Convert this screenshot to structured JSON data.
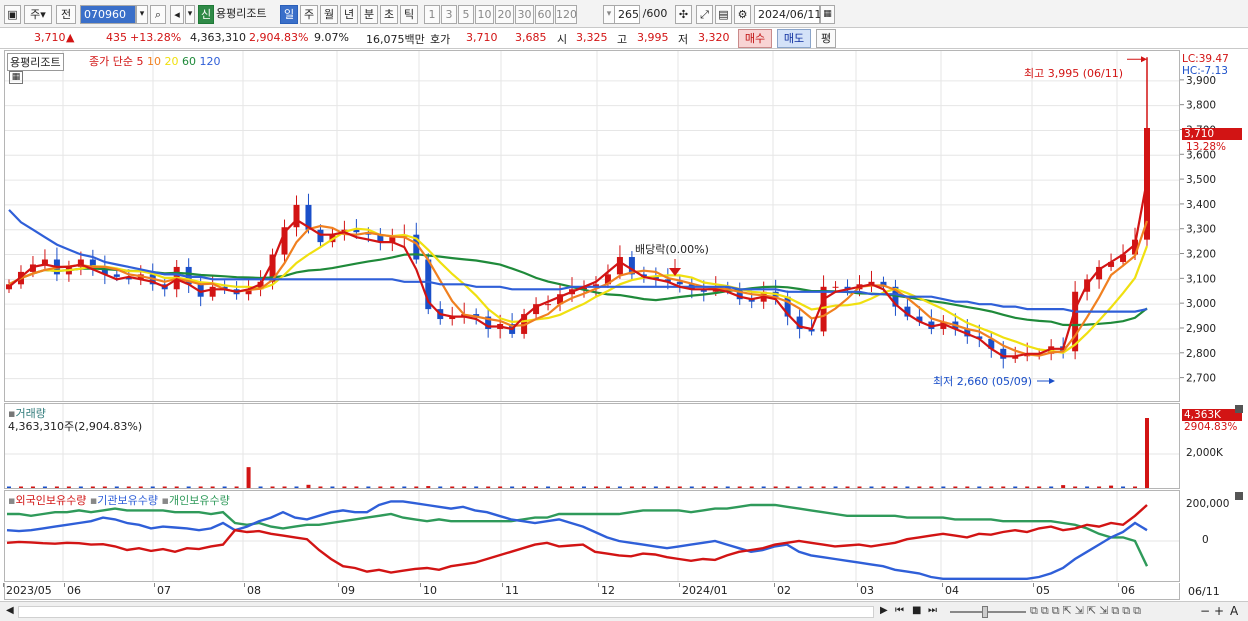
{
  "toolbar": {
    "market_label": "주",
    "prev_label": "전",
    "code_value": "070960",
    "stock_name": "용평리조트",
    "badge_new": "신",
    "periods": [
      "일",
      "주",
      "월",
      "년",
      "분",
      "초",
      "틱"
    ],
    "active_period": "일",
    "minute_steps": [
      "1",
      "3",
      "5",
      "10",
      "20",
      "30",
      "60",
      "120"
    ],
    "count_value": "265",
    "count_total": "/600",
    "date_value": "2024/06/11"
  },
  "info": {
    "price": "3,710",
    "change_arrow": "▲",
    "change": "435",
    "change_pct": "+13.28%",
    "volume": "4,363,310",
    "volume_pct": "2,904.83%",
    "turnover": "9.07%",
    "amount": "16,075백만",
    "quote_label": "호가",
    "ask": "3,710",
    "bid": "3,685",
    "open_label": "시",
    "open": "3,325",
    "high_label": "고",
    "high": "3,995",
    "low_label": "저",
    "low": "3,320",
    "buy_label": "매수",
    "sell_label": "매도",
    "flat_label": "평"
  },
  "price_panel": {
    "name_tag": "용평리조트",
    "ma_legend_prefix": "종가 단순",
    "ma_periods": [
      "5",
      "10",
      "20",
      "60",
      "120"
    ],
    "ma_colors": [
      "#d21414",
      "#f08020",
      "#f0e010",
      "#1f8a3a",
      "#2f5fd8"
    ],
    "annot_high": "최고 3,995 (06/11)",
    "annot_low": "최저 2,660 (05/09)",
    "annot_dividend": "배당락(0.00%)",
    "lc_label": "LC:39.47",
    "hc_label": "HC:-7.13",
    "last_price_label": "3,710",
    "last_pct_label": "13.28%",
    "y_ticks": [
      "3,900",
      "3,800",
      "3,700",
      "3,600",
      "3,500",
      "3,400",
      "3,300",
      "3,200",
      "3,100",
      "3,000",
      "2,900",
      "2,800",
      "2,700"
    ]
  },
  "volume_panel": {
    "title": "거래량",
    "subtitle": "4,363,310주(2,904.83%)",
    "last_label": "4,363K",
    "last_pct": "2904.83%",
    "y_tick": "2,000K"
  },
  "holding_panel": {
    "legend": [
      "외국인보유수량",
      "기관보유수량",
      "개인보유수량"
    ],
    "colors": [
      "#d21414",
      "#2f5fd8",
      "#2f9a5a"
    ],
    "y_ticks": [
      "200,000",
      "0"
    ]
  },
  "x_axis": {
    "labels": [
      "2023/05",
      "06",
      "07",
      "08",
      "09",
      "10",
      "11",
      "12",
      "2024/01",
      "02",
      "03",
      "04",
      "05",
      "06"
    ],
    "right_label": "06/11"
  },
  "chart_data": {
    "type": "line",
    "title": "용평리조트",
    "x_start": "2023/05",
    "x_end": "2024/06/11",
    "y_range": [
      2650,
      3980
    ],
    "close_series": [
      3080,
      3130,
      3160,
      3180,
      3120,
      3150,
      3180,
      3150,
      3120,
      3110,
      3100,
      3120,
      3080,
      3060,
      3150,
      3080,
      3030,
      3070,
      3060,
      3040,
      3060,
      3090,
      3200,
      3310,
      3400,
      3300,
      3250,
      3280,
      3300,
      3290,
      3280,
      3250,
      3270,
      3280,
      3180,
      2980,
      2940,
      2950,
      2960,
      2950,
      2900,
      2920,
      2880,
      2960,
      3000,
      3000,
      3040,
      3060,
      3070,
      3080,
      3120,
      3190,
      3120,
      3110,
      3100,
      3090,
      3080,
      3060,
      3050,
      3070,
      3060,
      3020,
      3010,
      3050,
      3030,
      2950,
      2900,
      2890,
      3070,
      3070,
      3060,
      3080,
      3090,
      3070,
      2990,
      2950,
      2930,
      2900,
      2930,
      2900,
      2870,
      2860,
      2820,
      2780,
      2790,
      2800,
      2800,
      2830,
      2810,
      3050,
      3100,
      3150,
      3170,
      3200,
      3260,
      3710
    ],
    "ma_series": [
      {
        "name": "5",
        "values": [
          3070,
          3110,
          3150,
          3160,
          3150,
          3150,
          3160,
          3140,
          3120,
          3100,
          3110,
          3100,
          3090,
          3070,
          3100,
          3080,
          3050,
          3060,
          3060,
          3050,
          3060,
          3080,
          3170,
          3290,
          3340,
          3310,
          3280,
          3280,
          3290,
          3270,
          3260,
          3250,
          3250,
          3230,
          3140,
          3010,
          2960,
          2950,
          2950,
          2940,
          2910,
          2910,
          2900,
          2950,
          2990,
          3010,
          3030,
          3050,
          3070,
          3090,
          3130,
          3170,
          3140,
          3110,
          3100,
          3090,
          3070,
          3060,
          3060,
          3060,
          3050,
          3030,
          3020,
          3030,
          3020,
          2960,
          2910,
          2900,
          3020,
          3050,
          3060,
          3070,
          3080,
          3060,
          3000,
          2960,
          2930,
          2910,
          2920,
          2900,
          2880,
          2860,
          2820,
          2790,
          2790,
          2800,
          2800,
          2820,
          2820,
          2980,
          3080,
          3140,
          3170,
          3200,
          3240,
          3500
        ]
      },
      {
        "name": "120",
        "values": [
          3380,
          3330,
          3300,
          3270,
          3240,
          3220,
          3200,
          3190,
          3170,
          3160,
          3150,
          3140,
          3130,
          3120,
          3120,
          3110,
          3110,
          3100,
          3100,
          3100,
          3100,
          3100,
          3100,
          3100,
          3100,
          3100,
          3100,
          3100,
          3100,
          3100,
          3100,
          3100,
          3100,
          3090,
          3090,
          3090,
          3080,
          3080,
          3080,
          3070,
          3070,
          3070,
          3060,
          3060,
          3060,
          3060,
          3060,
          3070,
          3070,
          3070,
          3070,
          3070,
          3070,
          3070,
          3070,
          3070,
          3070,
          3070,
          3070,
          3070,
          3070,
          3060,
          3060,
          3060,
          3060,
          3050,
          3050,
          3050,
          3050,
          3050,
          3050,
          3050,
          3040,
          3040,
          3040,
          3030,
          3030,
          3030,
          3020,
          3010,
          3010,
          3000,
          3000,
          2990,
          2990,
          2980,
          2980,
          2980,
          2980,
          2970,
          2970,
          2970,
          2970,
          2970,
          2970,
          2980
        ]
      }
    ],
    "volume_last": 4363310,
    "holdings": {
      "x_count": 96,
      "foreign": [
        -10000,
        -5000,
        -8000,
        -12000,
        -15000,
        -10000,
        -12000,
        -20000,
        -18000,
        -30000,
        -50000,
        -40000,
        -55000,
        -45000,
        -60000,
        -40000,
        -45000,
        -30000,
        -20000,
        60000,
        50000,
        55000,
        40000,
        30000,
        20000,
        10000,
        -50000,
        -100000,
        -140000,
        -150000,
        -170000,
        -160000,
        -175000,
        -165000,
        -155000,
        -150000,
        -160000,
        -140000,
        -130000,
        -120000,
        -100000,
        -80000,
        -60000,
        -40000,
        -20000,
        -10000,
        -30000,
        -25000,
        -20000,
        -60000,
        -70000,
        -80000,
        -85000,
        -70000,
        -75000,
        -90000,
        -100000,
        -110000,
        -100000,
        -105000,
        -80000,
        -60000,
        -50000,
        -40000,
        -20000,
        -10000,
        0,
        -10000,
        -20000,
        -30000,
        -25000,
        -20000,
        -30000,
        -20000,
        -10000,
        10000,
        20000,
        30000,
        40000,
        30000,
        20000,
        40000,
        35000,
        50000,
        60000,
        50000,
        70000,
        80000,
        60000,
        70000,
        90000,
        80000,
        100000,
        90000,
        140000,
        200000
      ],
      "institution": [
        60000,
        55000,
        60000,
        70000,
        80000,
        90000,
        100000,
        110000,
        130000,
        120000,
        100000,
        90000,
        70000,
        80000,
        75000,
        70000,
        60000,
        70000,
        100000,
        60000,
        80000,
        110000,
        130000,
        160000,
        130000,
        120000,
        140000,
        160000,
        170000,
        160000,
        160000,
        200000,
        220000,
        220000,
        210000,
        200000,
        190000,
        180000,
        190000,
        170000,
        160000,
        140000,
        120000,
        110000,
        100000,
        110000,
        120000,
        100000,
        80000,
        50000,
        20000,
        0,
        -10000,
        -20000,
        -30000,
        -40000,
        -30000,
        -20000,
        -10000,
        0,
        -20000,
        -40000,
        -60000,
        -50000,
        -30000,
        -20000,
        -60000,
        -80000,
        -90000,
        -100000,
        -110000,
        -120000,
        -130000,
        -140000,
        -160000,
        -170000,
        -180000,
        -200000,
        -210000,
        -210000,
        -210000,
        -210000,
        -210000,
        -210000,
        -210000,
        -210000,
        -200000,
        -180000,
        -150000,
        -100000,
        -60000,
        -20000,
        20000,
        50000,
        100000,
        60000
      ],
      "individual": [
        150000,
        150000,
        140000,
        150000,
        160000,
        160000,
        170000,
        160000,
        170000,
        180000,
        170000,
        170000,
        170000,
        170000,
        160000,
        160000,
        160000,
        150000,
        160000,
        100000,
        90000,
        100000,
        80000,
        70000,
        80000,
        90000,
        90000,
        100000,
        110000,
        120000,
        130000,
        140000,
        150000,
        130000,
        120000,
        110000,
        120000,
        110000,
        110000,
        110000,
        110000,
        110000,
        110000,
        120000,
        130000,
        130000,
        150000,
        150000,
        150000,
        150000,
        150000,
        150000,
        160000,
        170000,
        170000,
        170000,
        170000,
        160000,
        170000,
        180000,
        180000,
        190000,
        200000,
        200000,
        200000,
        190000,
        180000,
        170000,
        160000,
        150000,
        140000,
        140000,
        140000,
        140000,
        140000,
        130000,
        130000,
        130000,
        130000,
        120000,
        120000,
        120000,
        120000,
        110000,
        110000,
        110000,
        110000,
        110000,
        100000,
        90000,
        70000,
        40000,
        20000,
        20000,
        0,
        -140000
      ]
    }
  }
}
